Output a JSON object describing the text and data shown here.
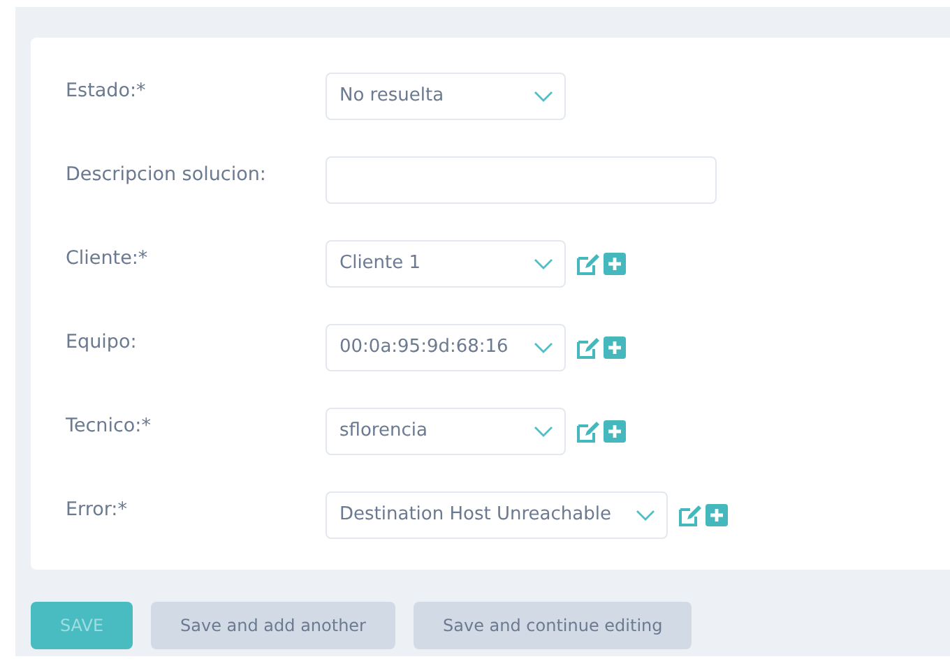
{
  "fields": [
    {
      "kind": "select",
      "label": "Estado:*",
      "value": "No resuelta",
      "actions": false,
      "wide": false
    },
    {
      "kind": "text",
      "label": "Descripcion solucion:"
    },
    {
      "kind": "select",
      "label": "Cliente:*",
      "value": "Cliente 1",
      "actions": true,
      "wide": false
    },
    {
      "kind": "select",
      "label": "Equipo:",
      "value": "00:0a:95:9d:68:16",
      "actions": true,
      "wide": false
    },
    {
      "kind": "select",
      "label": "Tecnico:*",
      "value": "sflorencia",
      "actions": true,
      "wide": false
    },
    {
      "kind": "select",
      "label": "Error:*",
      "value": "Destination Host Unreachable",
      "actions": true,
      "wide": true
    }
  ],
  "buttons": [
    {
      "kind": "primary",
      "label": "SAVE"
    },
    {
      "kind": "secondary",
      "label": "Save and add another"
    },
    {
      "kind": "secondary",
      "label": "Save and continue editing"
    }
  ]
}
